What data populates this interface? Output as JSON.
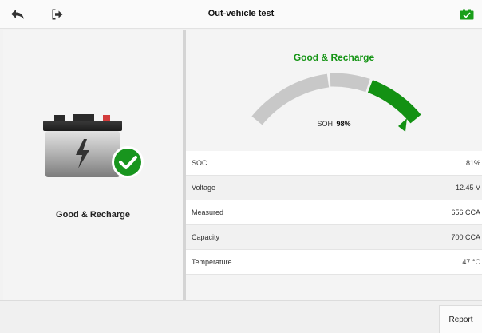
{
  "header": {
    "title": "Out-vehicle test",
    "icons": {
      "back": "back-arrow-icon",
      "exit": "exit-icon",
      "status": "battery-status-icon"
    }
  },
  "left": {
    "status": "Good & Recharge"
  },
  "right": {
    "status": "Good & Recharge",
    "soh_label": "SOH",
    "soh_value": "98%",
    "gauge": {
      "soh_fraction": 0.98,
      "zones": [
        "gray",
        "gray",
        "green"
      ]
    },
    "rows": [
      {
        "label": "SOC",
        "value": "81%"
      },
      {
        "label": "Voltage",
        "value": "12.45 V"
      },
      {
        "label": "Measured",
        "value": "656 CCA"
      },
      {
        "label": "Capacity",
        "value": "700 CCA"
      },
      {
        "label": "Temperature",
        "value": "47 °C"
      }
    ]
  },
  "footer": {
    "report_label": "Report"
  },
  "colors": {
    "good": "#149414",
    "gauge_gray": "#c8c8c8",
    "battery_status": "#1a9e1a"
  }
}
